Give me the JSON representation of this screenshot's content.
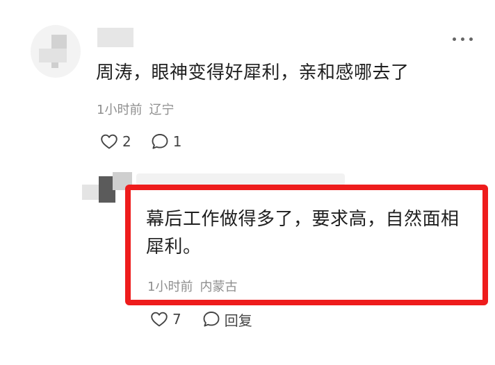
{
  "main_comment": {
    "text": "周涛，眼神变得好犀利，亲和感哪去了",
    "time": "1小时前",
    "location": "辽宁",
    "likes": "2",
    "replies": "1"
  },
  "reply": {
    "text": "幕后工作做得多了，要求高，自然面相犀利。",
    "time": "1小时前",
    "location": "内蒙古",
    "likes": "7",
    "reply_label": "回复"
  },
  "colors": {
    "highlight_border": "#ee1c1c",
    "meta_text": "#8e8e8e"
  }
}
